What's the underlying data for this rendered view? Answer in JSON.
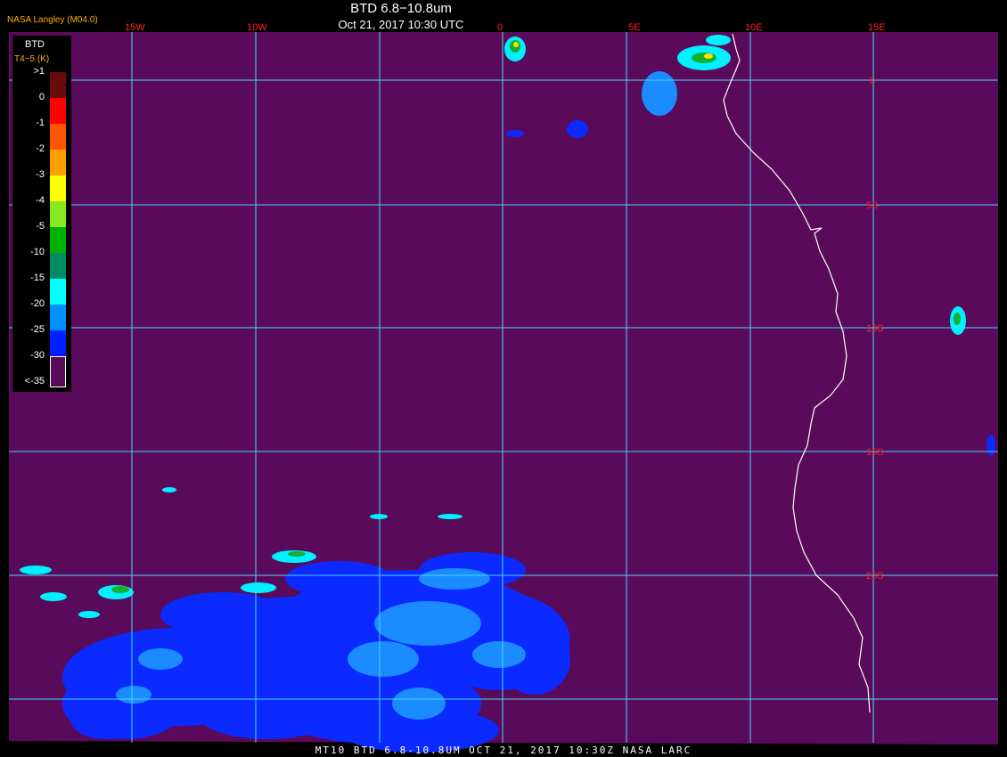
{
  "header": {
    "brand": "NASA Langley (M04.0)",
    "title": "BTD 6.8−10.8um",
    "subtitle": "Oct 21, 2017 10:30 UTC"
  },
  "footer": {
    "text": "MT10  BTD 6.8-10.8UM  OCT 21, 2017 10:30Z  NASA LARC"
  },
  "legend": {
    "title": "BTD",
    "units": "T4−5 (K)",
    "bins": [
      {
        "label": ">1",
        "color": "#6a0a0a"
      },
      {
        "label": "0",
        "color": "#ff0000"
      },
      {
        "label": "-1",
        "color": "#ff5500"
      },
      {
        "label": "-2",
        "color": "#ffa000"
      },
      {
        "label": "-3",
        "color": "#ffff00"
      },
      {
        "label": "-4",
        "color": "#88e820"
      },
      {
        "label": "-5",
        "color": "#00b000"
      },
      {
        "label": "-10",
        "color": "#008a66"
      },
      {
        "label": "-15",
        "color": "#00ffff"
      },
      {
        "label": "-20",
        "color": "#0090ff"
      },
      {
        "label": "-25",
        "color": "#0020ff"
      },
      {
        "label": "-30",
        "color": "#5a0a5a"
      },
      {
        "label": "<-35",
        "color": ""
      }
    ]
  },
  "map": {
    "background": "#5a0a5a",
    "grid_color": "#48d8ff",
    "label_color": "#ff2020",
    "coast_color": "#ffffff",
    "lon_labels": [
      "15W",
      "10W",
      "0",
      "5E",
      "10E",
      "15E"
    ],
    "lat_labels": [
      "0",
      "5S",
      "10S",
      "15S",
      "20S"
    ]
  }
}
